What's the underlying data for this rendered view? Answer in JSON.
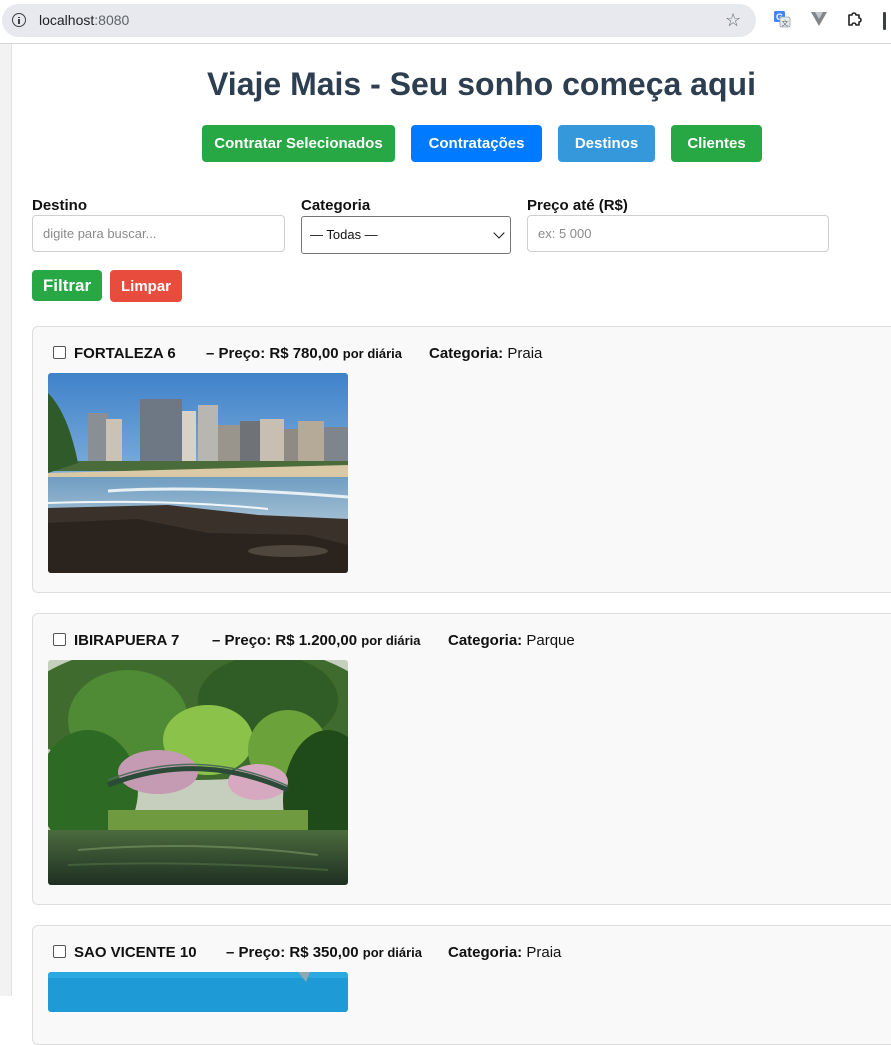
{
  "browser": {
    "url_host": "localhost",
    "url_port": ":8080",
    "icons": [
      "info-icon",
      "star-icon",
      "translate-icon",
      "vue-devtools-icon",
      "extensions-icon"
    ]
  },
  "page": {
    "title": "Viaje Mais - Seu sonho começa aqui"
  },
  "nav": {
    "contratar_selecionados": "Contratar Selecionados",
    "contratacoes": "Contratações",
    "destinos": "Destinos",
    "clientes": "Clientes"
  },
  "filters": {
    "destino_label": "Destino",
    "destino_placeholder": "digite para buscar...",
    "destino_value": "",
    "categoria_label": "Categoria",
    "categoria_selected": "— Todas —",
    "preco_label": "Preço até (R$)",
    "preco_placeholder": "ex: 5 000",
    "preco_value": "",
    "filtrar": "Filtrar",
    "limpar": "Limpar"
  },
  "colors": {
    "green": "#28a745",
    "blue": "#007bff",
    "light_blue": "#3498db",
    "red": "#e74c3c",
    "title": "#2c3e50"
  },
  "destinations": [
    {
      "name": "FORTALEZA 6",
      "price_label": "– Preço: R$ 780,00",
      "per": "por diária",
      "category_label": "Categoria:",
      "category": "Praia",
      "checked": false,
      "image": "city-beach-photo"
    },
    {
      "name": "IBIRAPUERA 7",
      "price_label": "– Preço: R$ 1.200,00",
      "per": "por diária",
      "category_label": "Categoria:",
      "category": "Parque",
      "checked": false,
      "image": "park-bridge-photo"
    },
    {
      "name": "SAO VICENTE 10",
      "price_label": "– Preço: R$ 350,00",
      "per": "por diária",
      "category_label": "Categoria:",
      "category": "Praia",
      "checked": false,
      "image": "beach-photo"
    }
  ]
}
